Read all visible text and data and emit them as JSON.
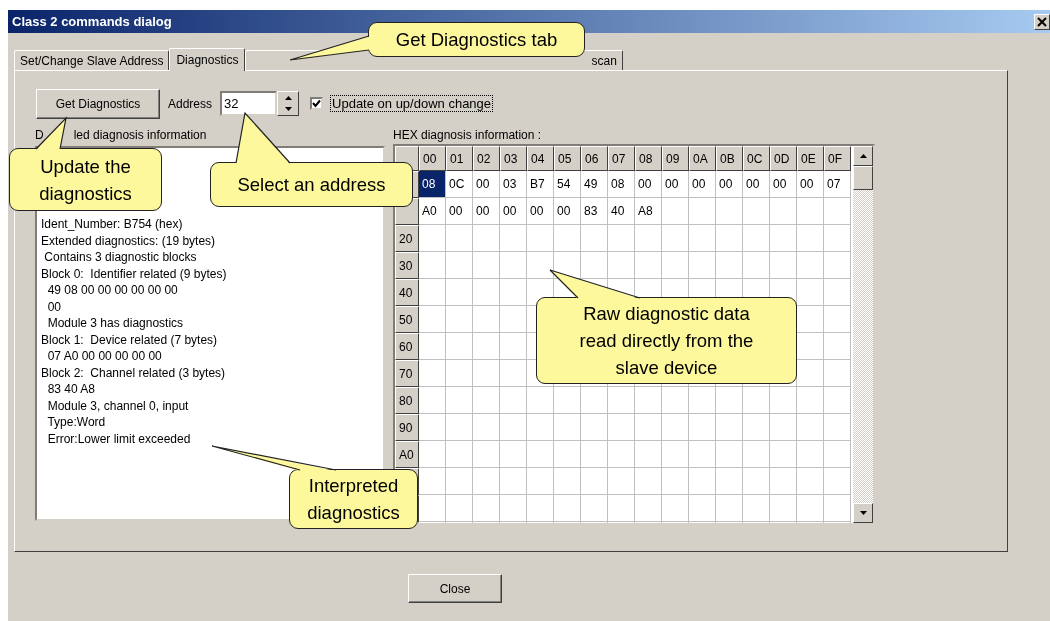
{
  "window": {
    "title": "Class 2 commands dialog"
  },
  "tabs": [
    {
      "label": "Set/Change Slave Address",
      "selected": false
    },
    {
      "label": "Diagnostics",
      "selected": true
    },
    {
      "label": "scan",
      "selected": false
    }
  ],
  "toolbar": {
    "get_button": "Get Diagnostics",
    "address_label": "Address",
    "address_value": "32",
    "update_checkbox": {
      "label": "Update on up/down change",
      "checked": true
    }
  },
  "detail_panel": {
    "label_parts": [
      "D",
      "led diagnosis information"
    ],
    "lines": [
      "Ident_Number: B754 (hex)",
      "Extended diagnostics: (19 bytes)",
      " Contains 3 diagnostic blocks",
      "Block 0:  Identifier related (9 bytes)",
      "  49 08 00 00 00 00 00 00",
      "  00",
      "  Module 3 has diagnostics",
      "Block 1:  Device related (7 bytes)",
      "  07 A0 00 00 00 00 00",
      "Block 2:  Channel related (3 bytes)",
      "  83 40 A8",
      "  Module 3, channel 0, input",
      "  Type:Word",
      "  Error:Lower limit exceeded"
    ]
  },
  "hex_panel": {
    "label": "HEX diagnosis information :",
    "columns": [
      "00",
      "01",
      "02",
      "03",
      "04",
      "05",
      "06",
      "07",
      "08",
      "09",
      "0A",
      "0B",
      "0C",
      "0D",
      "0E",
      "0F"
    ],
    "rows": [
      {
        "cells": [
          {
            "value": "08",
            "selected": true
          },
          {
            "value": "0C",
            "selected": false
          },
          {
            "value": "00",
            "selected": false
          },
          {
            "value": "03",
            "selected": false
          },
          {
            "value": "B7",
            "selected": false
          },
          {
            "value": "54",
            "selected": false
          },
          {
            "value": "49",
            "selected": false
          },
          {
            "value": "08",
            "selected": false
          },
          {
            "value": "00",
            "selected": false
          },
          {
            "value": "00",
            "selected": false
          },
          {
            "value": "00",
            "selected": false
          },
          {
            "value": "00",
            "selected": false
          },
          {
            "value": "00",
            "selected": false
          },
          {
            "value": "00",
            "selected": false
          },
          {
            "value": "00",
            "selected": false
          },
          {
            "value": "07",
            "selected": false
          }
        ]
      },
      {
        "cells": [
          {
            "value": "A0",
            "selected": false
          },
          {
            "value": "00",
            "selected": false
          },
          {
            "value": "00",
            "selected": false
          },
          {
            "value": "00",
            "selected": false
          },
          {
            "value": "00",
            "selected": false
          },
          {
            "value": "00",
            "selected": false
          },
          {
            "value": "83",
            "selected": false
          },
          {
            "value": "40",
            "selected": false
          },
          {
            "value": "A8",
            "selected": false
          }
        ]
      },
      {
        "header": "20"
      },
      {
        "header": "30"
      },
      {
        "header": "40"
      },
      {
        "header": "50"
      },
      {
        "header": "60"
      },
      {
        "header": "70"
      },
      {
        "header": "80"
      },
      {
        "header": "90"
      },
      {
        "header": "A0"
      },
      {},
      {}
    ]
  },
  "close_button": "Close",
  "callouts": [
    "Get Diagnostics tab",
    "Update the diagnostics",
    "Select an address",
    "Raw diagnostic data read directly from the slave device",
    "Interpreted diagnostics"
  ]
}
